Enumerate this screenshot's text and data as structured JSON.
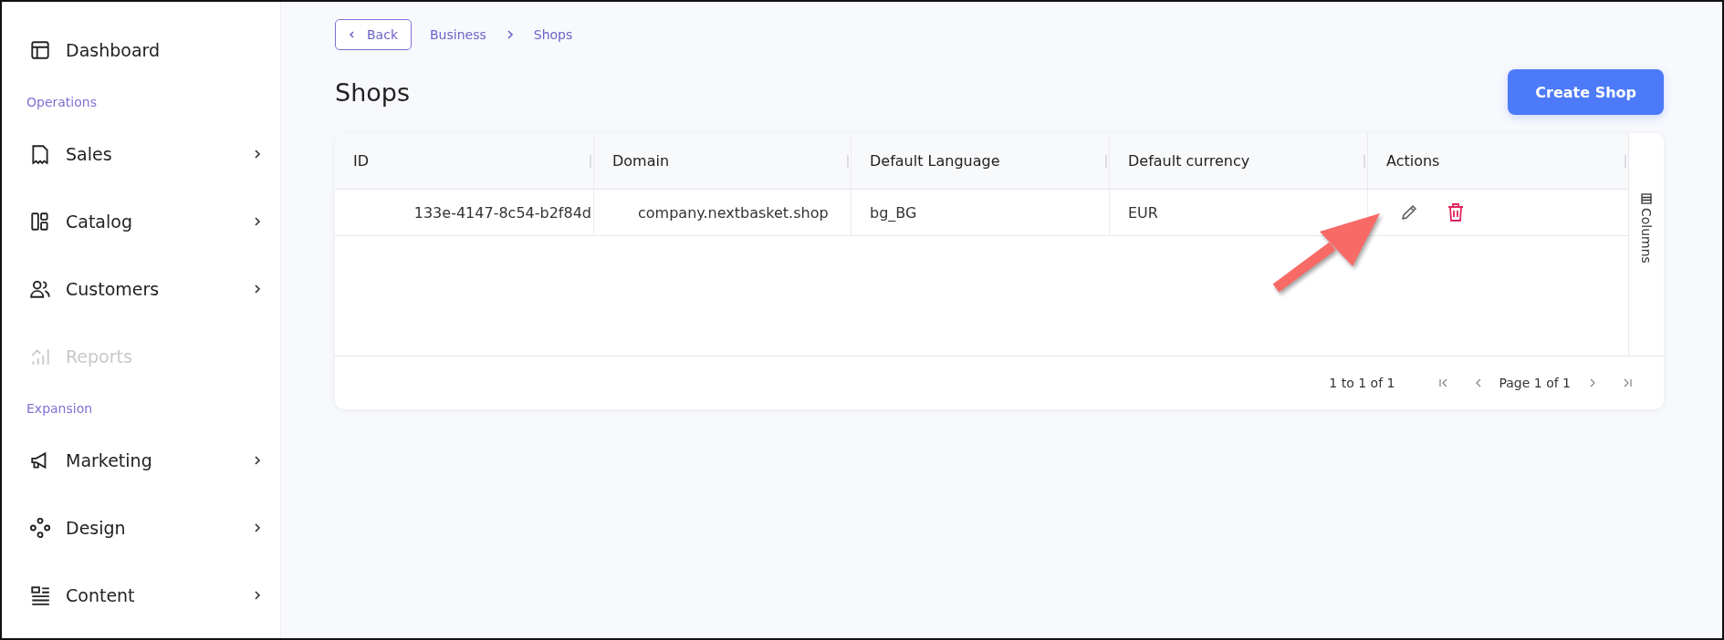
{
  "sidebar": {
    "items": [
      {
        "kind": "item",
        "label": "Dashboard",
        "expandable": false,
        "disabled": false
      },
      {
        "kind": "section",
        "label": "Operations"
      },
      {
        "kind": "item",
        "label": "Sales",
        "expandable": true,
        "disabled": false
      },
      {
        "kind": "item",
        "label": "Catalog",
        "expandable": true,
        "disabled": false
      },
      {
        "kind": "item",
        "label": "Customers",
        "expandable": true,
        "disabled": false
      },
      {
        "kind": "item",
        "label": "Reports",
        "expandable": false,
        "disabled": true
      },
      {
        "kind": "section",
        "label": "Expansion"
      },
      {
        "kind": "item",
        "label": "Marketing",
        "expandable": true,
        "disabled": false
      },
      {
        "kind": "item",
        "label": "Design",
        "expandable": true,
        "disabled": false
      },
      {
        "kind": "item",
        "label": "Content",
        "expandable": true,
        "disabled": false
      }
    ]
  },
  "back_button": "Back",
  "breadcrumb": [
    "Business",
    "Shops"
  ],
  "page_title": "Shops",
  "create_button": "Create Shop",
  "table": {
    "columns": [
      "ID",
      "Domain",
      "Default Language",
      "Default currency",
      "Actions"
    ],
    "rows": [
      {
        "cells": [
          "133e-4147-8c54-b2f84d",
          "company.nextbasket.shop",
          "bg_BG",
          "EUR"
        ]
      }
    ],
    "columns_panel": "Columns",
    "pagination": {
      "summary": "1 to 1 of 1",
      "page": "Page 1 of 1"
    }
  }
}
